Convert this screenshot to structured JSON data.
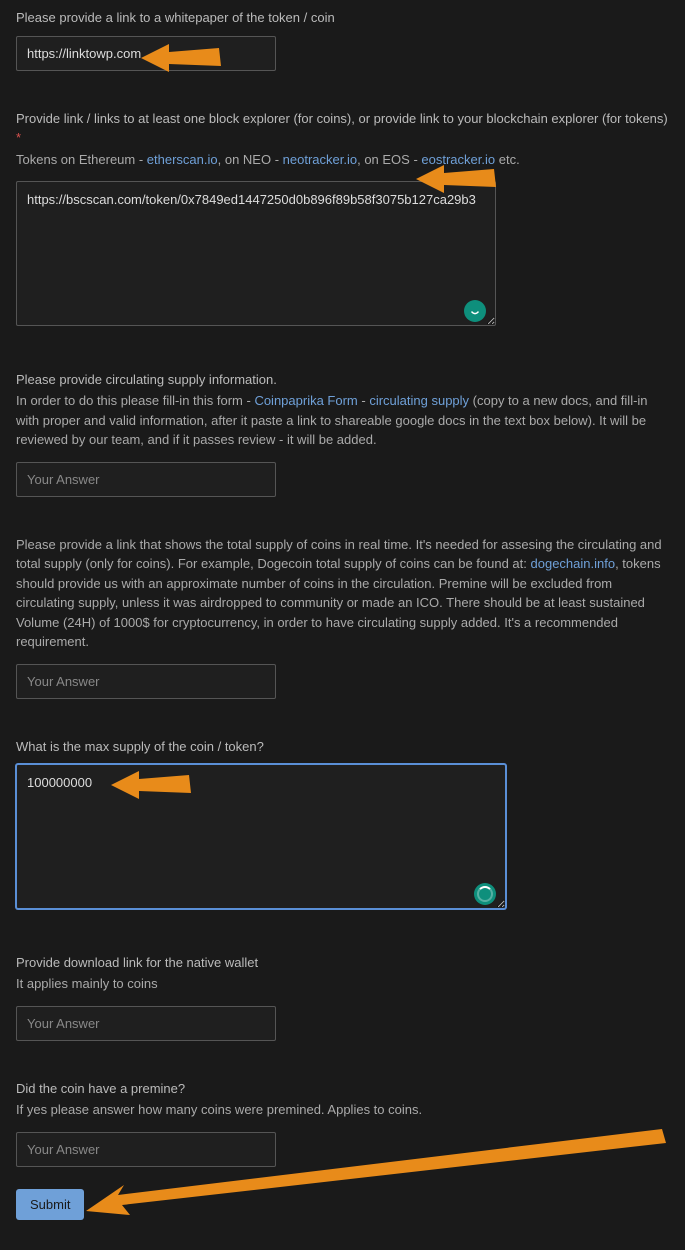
{
  "whitepaper": {
    "label": "Please provide a link to a whitepaper of the token / coin",
    "value": "https://linktowp.com"
  },
  "explorer": {
    "label_prefix": "Provide link / links to at least one block explorer (for coins), or provide link to your blockchain explorer (for tokens)",
    "required_mark": "*",
    "hint_pre": "Tokens on Ethereum - ",
    "link1": "etherscan.io",
    "hint_mid1": ", on NEO - ",
    "link2": "neotracker.io",
    "hint_mid2": ", on EOS - ",
    "link3": "eostracker.io",
    "hint_post": " etc.",
    "value": "https://bscscan.com/token/0x7849ed1447250d0b896f89b58f3075b127ca29b3"
  },
  "circulating": {
    "label": "Please provide circulating supply information.",
    "hint_pre": "In order to do this please fill-in this form - ",
    "link1": "Coinpaprika Form",
    "hint_mid": " - ",
    "link2": "circulating supply",
    "hint_post": " (copy to a new docs, and fill-in with proper and valid information, after it paste a link to shareable google docs in the text box below). It will be reviewed by our team, and if it passes review - it will be added.",
    "placeholder": "Your Answer"
  },
  "totalsupply": {
    "label_pre": "Please provide a link that shows the total supply of coins in real time. It's needed for assesing the circulating and total supply (only for coins). For example, Dogecoin total supply of coins can be found at: ",
    "link1": "dogechain.info",
    "label_post": ", tokens should provide us with an approximate number of coins in the circulation. Premine will be excluded from circulating supply, unless it was airdropped to community or made an ICO. There should be at least sustained Volume (24H) of 1000$ for cryptocurrency, in order to have circulating supply added. It's a recommended requirement.",
    "placeholder": "Your Answer"
  },
  "maxsupply": {
    "label": "What is the max supply of the coin / token?",
    "value": "100000000"
  },
  "wallet": {
    "label": "Provide download link for the native wallet",
    "hint": "It applies mainly to coins",
    "placeholder": "Your Answer"
  },
  "premine": {
    "label": "Did the coin have a premine?",
    "hint": "If yes please answer how many coins were premined. Applies to coins.",
    "placeholder": "Your Answer"
  },
  "submit": {
    "label": "Submit"
  }
}
